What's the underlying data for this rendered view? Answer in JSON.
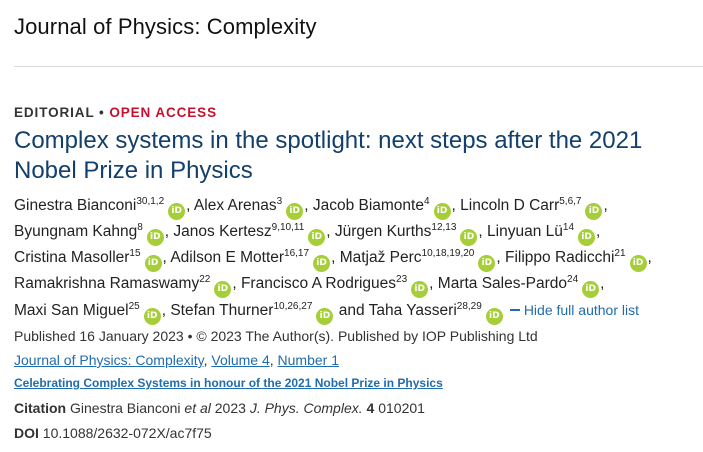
{
  "journal": {
    "title": "Journal of Physics: Complexity"
  },
  "article": {
    "type": "EDITORIAL",
    "separator": "•",
    "access": "OPEN ACCESS",
    "title": "Complex systems in the spotlight: next steps after the 2021 Nobel Prize in Physics"
  },
  "orcid_icon": "iD",
  "authors": [
    {
      "name": "Ginestra Bianconi",
      "aff": "30,1,2"
    },
    {
      "name": "Alex Arenas",
      "aff": "3"
    },
    {
      "name": "Jacob Biamonte",
      "aff": "4"
    },
    {
      "name": "Lincoln D Carr",
      "aff": "5,6,7"
    },
    {
      "name": "Byungnam Kahng",
      "aff": "8"
    },
    {
      "name": "Janos Kertesz",
      "aff": "9,10,11"
    },
    {
      "name": "Jürgen Kurths",
      "aff": "12,13"
    },
    {
      "name": "Linyuan Lü",
      "aff": "14"
    },
    {
      "name": "Cristina Masoller",
      "aff": "15"
    },
    {
      "name": "Adilson E Motter",
      "aff": "16,17"
    },
    {
      "name": "Matjaž Perc",
      "aff": "10,18,19,20"
    },
    {
      "name": "Filippo Radicchi",
      "aff": "21"
    },
    {
      "name": "Ramakrishna Ramaswamy",
      "aff": "22"
    },
    {
      "name": "Francisco A Rodrigues",
      "aff": "23"
    },
    {
      "name": "Marta Sales-Pardo",
      "aff": "24"
    },
    {
      "name": "Maxi San Miguel",
      "aff": "25"
    },
    {
      "name": "Stefan Thurner",
      "aff": "10,26,27"
    },
    {
      "name": "Taha Yasseri",
      "aff": "28,29"
    }
  ],
  "author_rows": [
    [
      0,
      1,
      2,
      3
    ],
    [
      4,
      5,
      6,
      7
    ],
    [
      8,
      9,
      10,
      11
    ],
    [
      12,
      13,
      14
    ],
    [
      15,
      16,
      17
    ]
  ],
  "and_word": "and",
  "hide_list_label": "Hide full author list",
  "published": "Published 16 January 2023 • © 2023 The Author(s). Published by IOP Publishing Ltd",
  "links": {
    "journal": "Journal of Physics: Complexity",
    "volume": "Volume 4",
    "number": "Number 1",
    "sep": ","
  },
  "collection": "Celebrating Complex Systems in honour of the 2021 Nobel Prize in Physics",
  "citation": {
    "label": "Citation",
    "author": "Ginestra Bianconi",
    "etal": "et al",
    "year": "2023",
    "journal_abbr": "J. Phys. Complex.",
    "volume": "4",
    "article_no": "010201"
  },
  "doi": {
    "label": "DOI",
    "value": "10.1088/2632-072X/ac7f75"
  },
  "colors": {
    "title": "#123f6c",
    "link": "#1f6cae",
    "open_access": "#c8102e",
    "orcid": "#a6ce39"
  }
}
